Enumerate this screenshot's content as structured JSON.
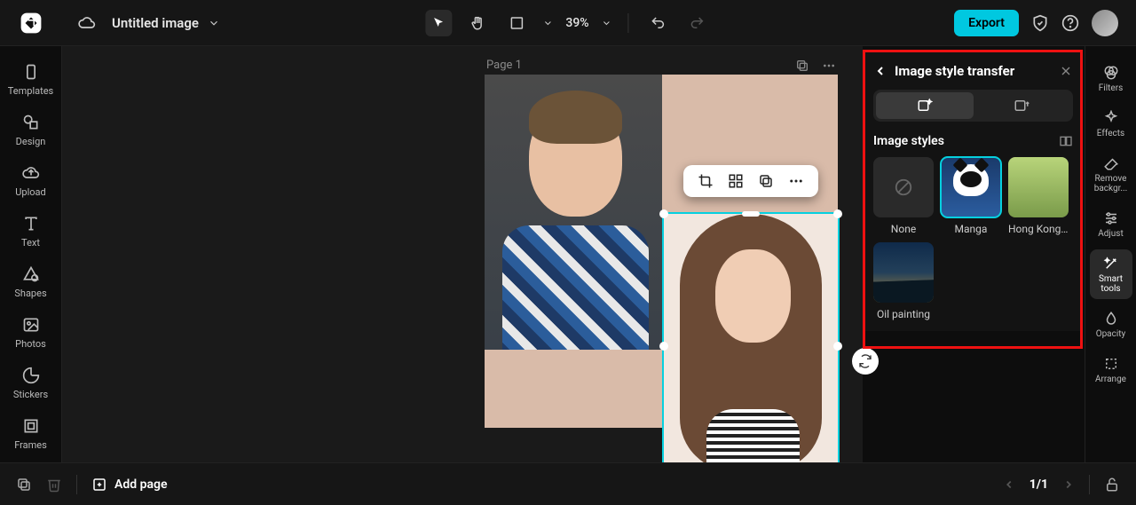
{
  "topbar": {
    "title": "Untitled image",
    "zoom": "39%",
    "export_label": "Export"
  },
  "left_rail": [
    {
      "label": "Templates"
    },
    {
      "label": "Design"
    },
    {
      "label": "Upload"
    },
    {
      "label": "Text"
    },
    {
      "label": "Shapes"
    },
    {
      "label": "Photos"
    },
    {
      "label": "Stickers"
    },
    {
      "label": "Frames"
    }
  ],
  "canvas": {
    "page_label": "Page 1"
  },
  "style_panel": {
    "title": "Image style transfer",
    "section_label": "Image styles",
    "styles": [
      {
        "label": "None"
      },
      {
        "label": "Manga"
      },
      {
        "label": "Hong Kong ..."
      },
      {
        "label": "Oil painting"
      }
    ]
  },
  "right_rail": [
    {
      "label": "Filters"
    },
    {
      "label": "Effects"
    },
    {
      "label": "Remove backgr..."
    },
    {
      "label": "Adjust"
    },
    {
      "label": "Smart tools"
    },
    {
      "label": "Opacity"
    },
    {
      "label": "Arrange"
    }
  ],
  "bottombar": {
    "add_page_label": "Add page",
    "page_counter": "1/1"
  }
}
